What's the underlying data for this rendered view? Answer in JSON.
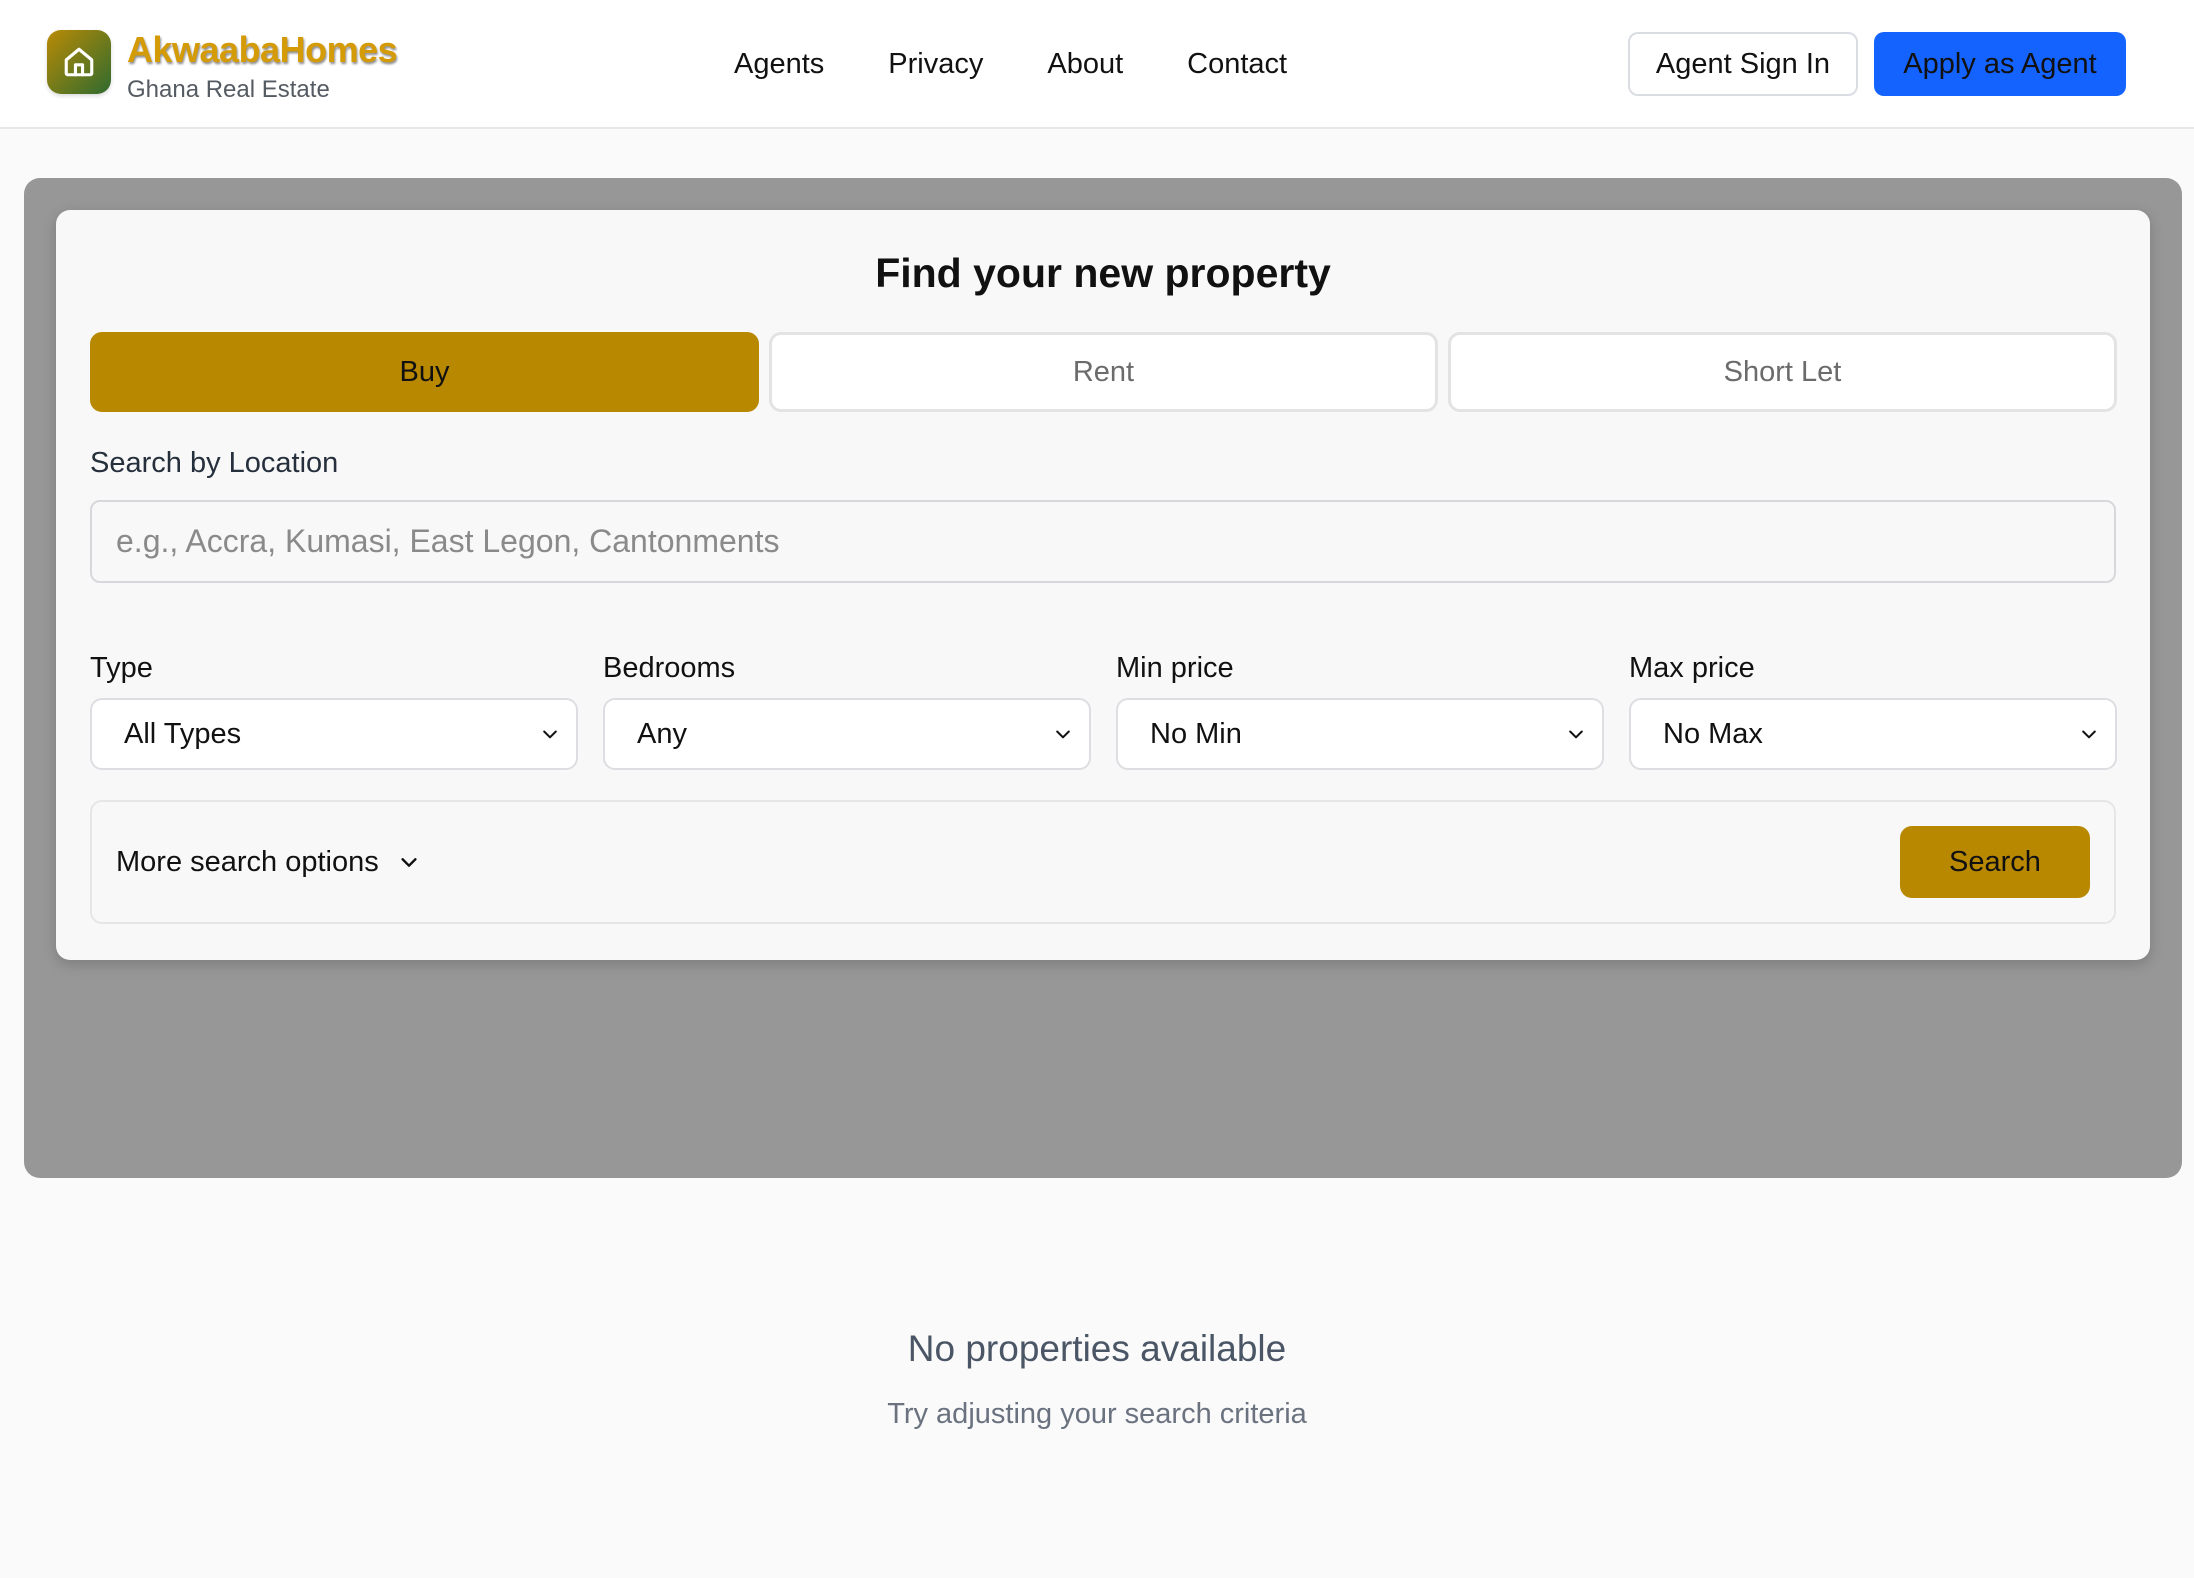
{
  "brand": {
    "name": "AkwaabaHomes",
    "tagline": "Ghana Real Estate",
    "logo_icon": "home-icon"
  },
  "nav": {
    "links": [
      "Agents",
      "Privacy",
      "About",
      "Contact"
    ]
  },
  "header_actions": {
    "sign_in": "Agent Sign In",
    "apply": "Apply as Agent"
  },
  "search": {
    "title": "Find your new property",
    "tabs": [
      {
        "label": "Buy",
        "active": true
      },
      {
        "label": "Rent",
        "active": false
      },
      {
        "label": "Short Let",
        "active": false
      }
    ],
    "location_label": "Search by Location",
    "location_placeholder": "e.g., Accra, Kumasi, East Legon, Cantonments",
    "filters": [
      {
        "label": "Type",
        "value": "All Types"
      },
      {
        "label": "Bedrooms",
        "value": "Any"
      },
      {
        "label": "Min price",
        "value": "No Min"
      },
      {
        "label": "Max price",
        "value": "No Max"
      }
    ],
    "more_options": "More search options",
    "submit": "Search"
  },
  "results": {
    "empty_title": "No properties available",
    "empty_subtitle": "Try adjusting your search criteria"
  },
  "colors": {
    "accent_gold": "#b88800",
    "primary_blue": "#1463ff",
    "hero_gray": "#979797"
  }
}
